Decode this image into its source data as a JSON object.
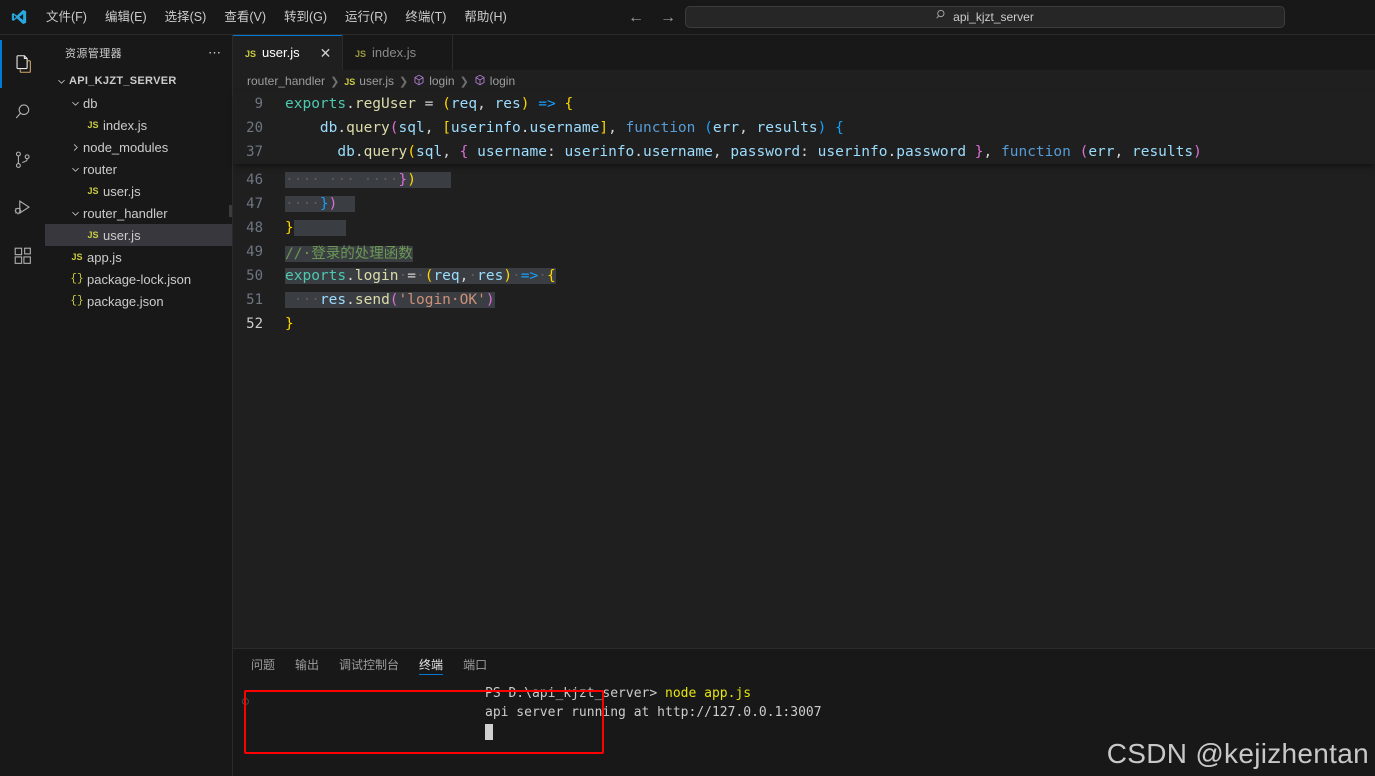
{
  "titlebar": {
    "logo_icon": "vscode-logo",
    "menus": [
      {
        "label": "文件(F)"
      },
      {
        "label": "编辑(E)"
      },
      {
        "label": "选择(S)"
      },
      {
        "label": "查看(V)"
      },
      {
        "label": "转到(G)"
      },
      {
        "label": "运行(R)"
      },
      {
        "label": "终端(T)"
      },
      {
        "label": "帮助(H)"
      }
    ],
    "nav_back_icon": "arrow-left-icon",
    "nav_forward_icon": "arrow-right-icon",
    "command_center": {
      "search_icon": "search-icon",
      "value": "api_kjzt_server"
    }
  },
  "activitybar": {
    "items": [
      {
        "name": "explorer",
        "icon": "files-icon",
        "active": true
      },
      {
        "name": "search",
        "icon": "search-icon",
        "active": false
      },
      {
        "name": "source-control",
        "icon": "source-control-icon",
        "active": false
      },
      {
        "name": "run-debug",
        "icon": "run-debug-icon",
        "active": false
      },
      {
        "name": "extensions",
        "icon": "extensions-icon",
        "active": false
      }
    ]
  },
  "sidebar": {
    "title": "资源管理器",
    "more_actions_icon": "ellipsis-icon",
    "tree": [
      {
        "label": "API_KJZT_SERVER",
        "kind": "root",
        "indent": 0,
        "expanded": true,
        "selected": false
      },
      {
        "label": "db",
        "kind": "folder",
        "indent": 1,
        "expanded": true,
        "selected": false
      },
      {
        "label": "index.js",
        "kind": "js",
        "indent": 2,
        "selected": false
      },
      {
        "label": "node_modules",
        "kind": "folder",
        "indent": 1,
        "expanded": false,
        "selected": false
      },
      {
        "label": "router",
        "kind": "folder",
        "indent": 1,
        "expanded": true,
        "selected": false
      },
      {
        "label": "user.js",
        "kind": "js",
        "indent": 2,
        "selected": false
      },
      {
        "label": "router_handler",
        "kind": "folder",
        "indent": 1,
        "expanded": true,
        "selected": false
      },
      {
        "label": "user.js",
        "kind": "js",
        "indent": 2,
        "selected": true
      },
      {
        "label": "app.js",
        "kind": "js",
        "indent": 1,
        "selected": false
      },
      {
        "label": "package-lock.json",
        "kind": "json",
        "indent": 1,
        "selected": false
      },
      {
        "label": "package.json",
        "kind": "json",
        "indent": 1,
        "selected": false
      }
    ]
  },
  "editor": {
    "tabs": [
      {
        "label": "user.js",
        "icon": "js-file-icon",
        "active": true,
        "close_icon": "close-icon"
      },
      {
        "label": "index.js",
        "icon": "js-file-icon",
        "active": false
      }
    ],
    "breadcrumb": [
      {
        "label": "router_handler",
        "icon": ""
      },
      {
        "label": "user.js",
        "icon": "js-file-icon"
      },
      {
        "label": "login",
        "icon": "symbol-method-icon"
      },
      {
        "label": "login",
        "icon": "symbol-method-icon"
      }
    ],
    "sticky_lines": [
      {
        "number": "9"
      },
      {
        "number": "20"
      },
      {
        "number": "37"
      }
    ],
    "code_lines": [
      {
        "number": "46"
      },
      {
        "number": "47"
      },
      {
        "number": "48"
      },
      {
        "number": "49"
      },
      {
        "number": "50"
      },
      {
        "number": "51"
      },
      {
        "number": "52"
      }
    ],
    "source_text": {
      "l9": "exports.regUser = (req, res) => {",
      "l20": "  db.query(sql, [userinfo.username], function (err, results) {",
      "l37": "    db.query(sql, { username: userinfo.username, password: userinfo.password }, function (err, results)",
      "l46": "        })",
      "l47": "    })",
      "l48": "}",
      "l49": "// 登录的处理函数",
      "l50": "exports.login = (req, res) => {",
      "l51": "    res.send('login OK')",
      "l52": "}"
    }
  },
  "panel": {
    "tabs": [
      {
        "label": "问题",
        "active": false
      },
      {
        "label": "输出",
        "active": false
      },
      {
        "label": "调试控制台",
        "active": false
      },
      {
        "label": "终端",
        "active": true
      },
      {
        "label": "端口",
        "active": false
      }
    ],
    "terminal": {
      "prompt": "PS D:\\api_kjzt_server>",
      "command": "node app.js",
      "output": "api server running at http://127.0.0.1:3007",
      "cursor": "block-cursor"
    },
    "highlight_color": "#ff0000"
  },
  "watermark": {
    "text": "CSDN @kejizhentan"
  },
  "colors": {
    "accent": "#0078d4",
    "bg": "#181818",
    "editor_bg": "#1f1f1f",
    "selection": "#3a3d41",
    "highlight_red": "#ff0000"
  }
}
